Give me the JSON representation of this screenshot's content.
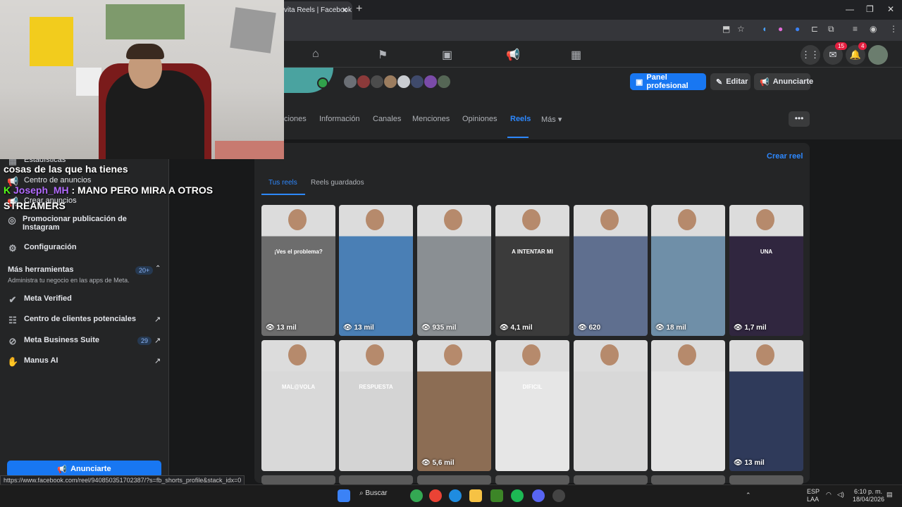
{
  "browser": {
    "tab_title": "vita Reels | Facebook",
    "tab_close": "✕",
    "new_tab": "+",
    "win_minimize": "—",
    "win_restore": "❐",
    "win_close": "✕"
  },
  "header": {
    "messenger_badge": "15",
    "notifications_badge": "4"
  },
  "profile": {
    "buttons": {
      "panel": "Panel profesional",
      "edit": "Editar",
      "advertise": "Anunciarte"
    },
    "tabs": [
      "ciones",
      "Información",
      "Canales",
      "Menciones",
      "Opiniones",
      "Reels",
      "Más ▾"
    ],
    "more_dots": "•••"
  },
  "sidebar": {
    "items": [
      {
        "icon": "stats-icon",
        "glyph": "▦",
        "label": "Estadísticas"
      },
      {
        "icon": "megaphone-icon",
        "glyph": "📢",
        "label": "Centro de anuncios"
      },
      {
        "icon": "megaphone-icon",
        "glyph": "📢",
        "label": "Crear anuncios"
      },
      {
        "icon": "instagram-icon",
        "glyph": "◎",
        "label": "Promocionar publicación de Instagram"
      },
      {
        "icon": "gear-icon",
        "glyph": "⚙",
        "label": "Configuración"
      }
    ],
    "more_tools": {
      "title": "Más herramientas",
      "count": "20+",
      "subtitle": "Administra tu negocio en las apps de Meta."
    },
    "tools": [
      {
        "icon": "verified-icon",
        "glyph": "✔",
        "label": "Meta Verified",
        "count": "",
        "external": ""
      },
      {
        "icon": "contacts-icon",
        "glyph": "☷",
        "label": "Centro de clientes potenciales",
        "count": "",
        "external": "↗"
      },
      {
        "icon": "business-suite-icon",
        "glyph": "⊘",
        "label": "Meta Business Suite",
        "count": "29",
        "external": "↗"
      },
      {
        "icon": "manus-icon",
        "glyph": "✋",
        "label": "Manus AI",
        "count": "",
        "external": "↗"
      }
    ],
    "advertise_button": "Anunciarte"
  },
  "reels": {
    "create": "Crear reel",
    "tabs": [
      "Tus reels",
      "Reels guardados"
    ],
    "row1": [
      {
        "views": "13 mil",
        "color": "#6d6d6d",
        "caption": "¡Ves el problema?"
      },
      {
        "views": "13 mil",
        "color": "#4a7fb5",
        "caption": ""
      },
      {
        "views": "935 mil",
        "color": "#8a8f93",
        "caption": ""
      },
      {
        "views": "4,1 mil",
        "color": "#3b3b3b",
        "caption": "A INTENTAR MI"
      },
      {
        "views": "620",
        "color": "#5f6f8f",
        "caption": ""
      },
      {
        "views": "18 mil",
        "color": "#6f8fa8",
        "caption": ""
      },
      {
        "views": "1,7 mil",
        "color": "#30263f",
        "caption": "UNA"
      }
    ],
    "row2": [
      {
        "views": "",
        "color": "#d9d9d9",
        "caption": "MAL@VOLA"
      },
      {
        "views": "",
        "color": "#d4d4d4",
        "caption": "RESPUESTA"
      },
      {
        "views": "5,6 mil",
        "color": "#8c6d54",
        "caption": ""
      },
      {
        "views": "",
        "color": "#e6e6e6",
        "caption": "DIFICIL"
      },
      {
        "views": "",
        "color": "#d8d8d8",
        "caption": ""
      },
      {
        "views": "",
        "color": "#e3e3e3",
        "caption": ""
      },
      {
        "views": "13 mil",
        "color": "#2f3a5a",
        "caption": ""
      }
    ]
  },
  "overlay": {
    "chat_line1": "cosas de las que ha tienes",
    "chat_user": "Joseph_MH",
    "chat_message": ": MANO PERO MIRA A OTROS STREAMERS",
    "kick_logo": "K"
  },
  "status_url": "https://www.facebook.com/reel/940850351702387/?s=fb_shorts_profile&stack_idx=0",
  "taskbar": {
    "search": "Buscar",
    "lang": "ESP",
    "lang2": "LAA",
    "time": "6:10 p. m.",
    "date": "18/04/2026"
  }
}
